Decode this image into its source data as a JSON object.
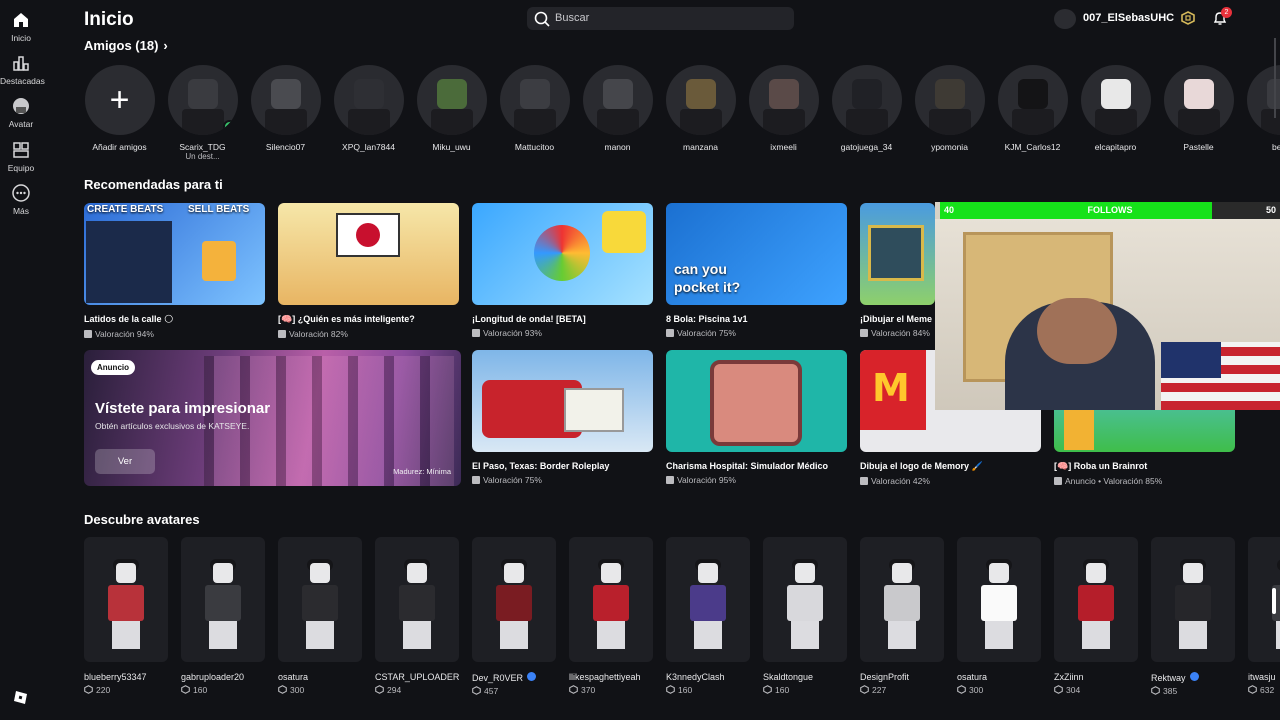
{
  "sidebar": {
    "items": [
      {
        "label": "Inicio",
        "icon": "home-icon"
      },
      {
        "label": "Destacadas",
        "icon": "chart-icon"
      },
      {
        "label": "Avatar",
        "icon": "avatar-icon"
      },
      {
        "label": "Equipo",
        "icon": "team-icon"
      },
      {
        "label": "Más",
        "icon": "more-icon"
      }
    ]
  },
  "header": {
    "title": "Inicio",
    "search_placeholder": "Buscar",
    "username": "007_ElSebasUHC",
    "notification_count": "2"
  },
  "friends": {
    "heading": "Amigos (18)",
    "add_label": "Añadir amigos",
    "list": [
      {
        "name": "Scarix_TDG",
        "status": "Un dest..."
      },
      {
        "name": "Silencio07",
        "status": ""
      },
      {
        "name": "XPQ_lan7844",
        "status": ""
      },
      {
        "name": "Miku_uwu",
        "status": ""
      },
      {
        "name": "Mattucitoo",
        "status": ""
      },
      {
        "name": "manon",
        "status": ""
      },
      {
        "name": "manzana",
        "status": ""
      },
      {
        "name": "ixmeeli",
        "status": ""
      },
      {
        "name": "gatojuega_34",
        "status": ""
      },
      {
        "name": "ypomonia",
        "status": ""
      },
      {
        "name": "KJM_Carlos12",
        "status": ""
      },
      {
        "name": "elcapitapro",
        "status": ""
      },
      {
        "name": "Pastelle",
        "status": ""
      },
      {
        "name": "bebe",
        "status": ""
      }
    ]
  },
  "recommended": {
    "heading": "Recomendadas para ti",
    "row1": [
      {
        "name": "Latidos de la calle 🌕",
        "rating": "Valoración 94%",
        "thumb_text_1": "CREATE BEATS",
        "thumb_text_2": "SELL BEATS"
      },
      {
        "name": "[🧠] ¿Quién es más inteligente?",
        "rating": "Valoración 82%"
      },
      {
        "name": "¡Longitud de onda! [BETA]",
        "rating": "Valoración 93%"
      },
      {
        "name": "8 Bola: Piscina 1v1",
        "rating": "Valoración 75%",
        "thumb_text_1": "can you",
        "thumb_text_2": "pocket it?"
      },
      {
        "name": "¡Dibujar el Meme",
        "rating": "Valoración 84%"
      }
    ],
    "ad": {
      "label": "Anuncio",
      "title": "Vístete para impresionar",
      "subtitle": "Obtén artículos exclusivos de KATSEYE.",
      "button": "Ver",
      "age": "Madurez: Mínima"
    },
    "row2": [
      {
        "name": "El Paso, Texas: Border Roleplay",
        "rating": "Valoración 75%"
      },
      {
        "name": "Charisma Hospital: Simulador Médico",
        "rating": "Valoración 95%"
      },
      {
        "name": "Dibuja el logo de Memory 🖌️",
        "rating": "Valoración 42%"
      },
      {
        "name": "[🧠] Roba un Brainrot",
        "rating": "Anuncio • Valoración 85%"
      }
    ]
  },
  "overlay": {
    "left": "40",
    "center": "FOLLOWS",
    "right": "50",
    "progress": 0.8
  },
  "avatars": {
    "heading": "Descubre avatares",
    "list": [
      {
        "name": "blueberry53347",
        "value": "220",
        "verified": false
      },
      {
        "name": "gabruploader20",
        "value": "160",
        "verified": false
      },
      {
        "name": "osatura",
        "value": "300",
        "verified": false
      },
      {
        "name": "CSTAR_UPLOADER",
        "value": "294",
        "verified": false
      },
      {
        "name": "Dev_R0VER",
        "value": "457",
        "verified": true
      },
      {
        "name": "llikespaghettiyeah",
        "value": "370",
        "verified": false
      },
      {
        "name": "K3nnedyClash",
        "value": "160",
        "verified": false
      },
      {
        "name": "Skaldtongue",
        "value": "160",
        "verified": false
      },
      {
        "name": "DesignProfit",
        "value": "227",
        "verified": false
      },
      {
        "name": "osatura",
        "value": "300",
        "verified": false
      },
      {
        "name": "ZxZiinn",
        "value": "304",
        "verified": false
      },
      {
        "name": "Rektway",
        "value": "385",
        "verified": true
      },
      {
        "name": "itwasju",
        "value": "632",
        "verified": false
      }
    ]
  }
}
